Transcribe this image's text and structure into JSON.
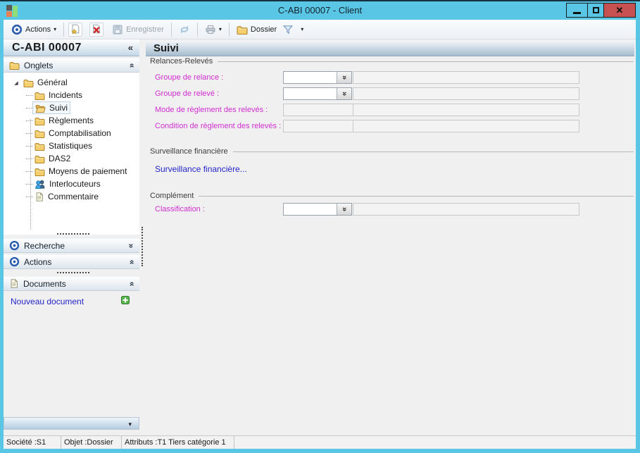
{
  "titlebar": {
    "title": "C-ABI 00007 -  Client",
    "close_glyph": "✕"
  },
  "toolbar": {
    "actions_label": "Actions",
    "enregistrer_label": "Enregistrer",
    "dossier_label": "Dossier"
  },
  "icons": {
    "chevron_double": "»",
    "sidebar_collapse": "«",
    "dropdown_arrow": "▾"
  },
  "sidebar": {
    "header": {
      "title": "C-ABI 00007"
    },
    "onglets": {
      "label": "Onglets"
    },
    "tree": [
      {
        "label": "Général"
      },
      {
        "label": "Incidents"
      },
      {
        "label": "Suivi"
      },
      {
        "label": "Règlements"
      },
      {
        "label": "Comptabilisation"
      },
      {
        "label": "Statistiques"
      },
      {
        "label": "DAS2"
      },
      {
        "label": "Moyens de paiement"
      },
      {
        "label": "Interlocuteurs"
      },
      {
        "label": "Commentaire"
      }
    ],
    "recherche": {
      "label": "Recherche"
    },
    "actions": {
      "label": "Actions"
    },
    "documents": {
      "label": "Documents"
    },
    "nouveau_document_label": "Nouveau document"
  },
  "main": {
    "title": "Suivi",
    "relances": {
      "title": "Relances-Relevés",
      "rows": [
        {
          "label": "Groupe de relance :",
          "value": ""
        },
        {
          "label": "Groupe de relevé :",
          "value": ""
        },
        {
          "label": "Mode de règlement des relevés :",
          "value": ""
        },
        {
          "label": "Condition de règlement des relevés :",
          "value": ""
        }
      ]
    },
    "surveillance": {
      "title": "Surveillance financière",
      "link": "Surveillance financière..."
    },
    "complement": {
      "title": "Complément",
      "rows": [
        {
          "label": "Classification :",
          "value": ""
        }
      ]
    }
  },
  "statusbar": {
    "cells": [
      "Société :S1",
      "Objet :Dossier",
      "Attributs :T1 Tiers catégorie 1",
      ""
    ]
  }
}
